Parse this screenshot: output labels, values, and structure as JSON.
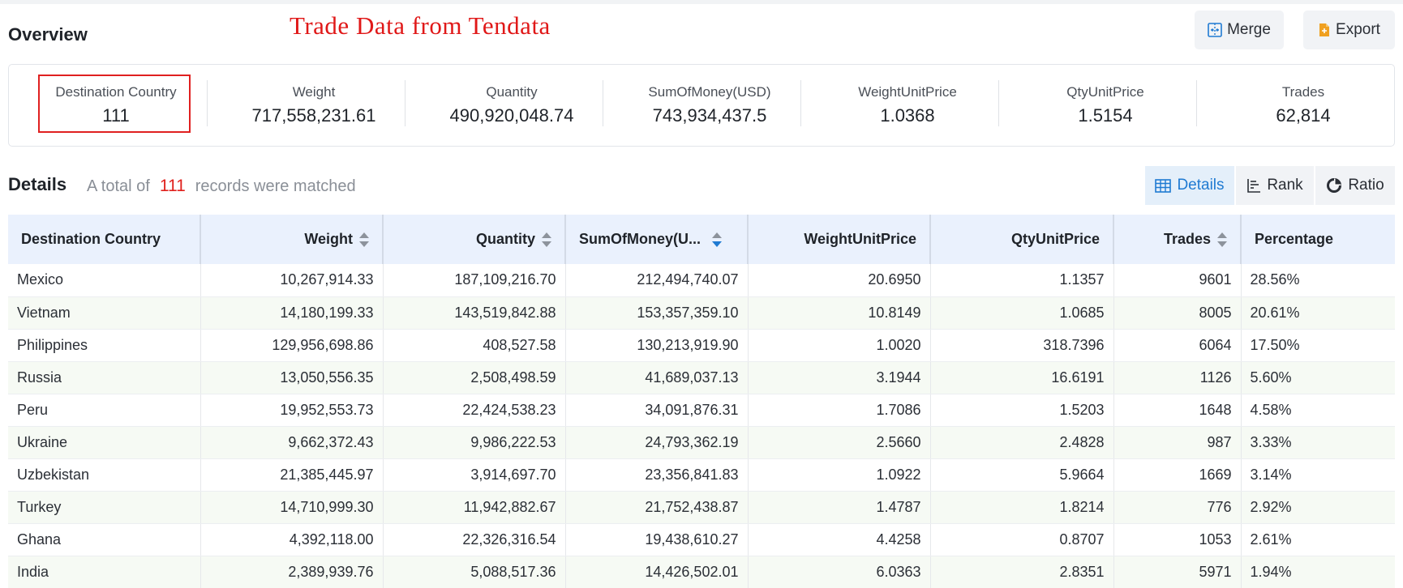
{
  "header": {
    "title": "Overview",
    "watermark": "Trade Data from Tendata",
    "merge_label": "Merge",
    "export_label": "Export"
  },
  "summary": [
    {
      "label": "Destination Country",
      "value": "111"
    },
    {
      "label": "Weight",
      "value": "717,558,231.61"
    },
    {
      "label": "Quantity",
      "value": "490,920,048.74"
    },
    {
      "label": "SumOfMoney(USD)",
      "value": "743,934,437.5"
    },
    {
      "label": "WeightUnitPrice",
      "value": "1.0368"
    },
    {
      "label": "QtyUnitPrice",
      "value": "1.5154"
    },
    {
      "label": "Trades",
      "value": "62,814"
    }
  ],
  "details": {
    "title": "Details",
    "prefix": "A total of",
    "count": "111",
    "suffix": "records were matched",
    "tabs": [
      {
        "label": "Details",
        "icon": "table-icon",
        "active": true
      },
      {
        "label": "Rank",
        "icon": "rank-icon",
        "active": false
      },
      {
        "label": "Ratio",
        "icon": "pie-icon",
        "active": false
      }
    ]
  },
  "table": {
    "columns": [
      "Destination Country",
      "Weight",
      "Quantity",
      "SumOfMoney(U...",
      "WeightUnitPrice",
      "QtyUnitPrice",
      "Trades",
      "Percentage"
    ],
    "rows": [
      [
        "Mexico",
        "10,267,914.33",
        "187,109,216.70",
        "212,494,740.07",
        "20.6950",
        "1.1357",
        "9601",
        "28.56%"
      ],
      [
        "Vietnam",
        "14,180,199.33",
        "143,519,842.88",
        "153,357,359.10",
        "10.8149",
        "1.0685",
        "8005",
        "20.61%"
      ],
      [
        "Philippines",
        "129,956,698.86",
        "408,527.58",
        "130,213,919.90",
        "1.0020",
        "318.7396",
        "6064",
        "17.50%"
      ],
      [
        "Russia",
        "13,050,556.35",
        "2,508,498.59",
        "41,689,037.13",
        "3.1944",
        "16.6191",
        "1126",
        "5.60%"
      ],
      [
        "Peru",
        "19,952,553.73",
        "22,424,538.23",
        "34,091,876.31",
        "1.7086",
        "1.5203",
        "1648",
        "4.58%"
      ],
      [
        "Ukraine",
        "9,662,372.43",
        "9,986,222.53",
        "24,793,362.19",
        "2.5660",
        "2.4828",
        "987",
        "3.33%"
      ],
      [
        "Uzbekistan",
        "21,385,445.97",
        "3,914,697.70",
        "23,356,841.83",
        "1.0922",
        "5.9664",
        "1669",
        "3.14%"
      ],
      [
        "Turkey",
        "14,710,999.30",
        "11,942,882.67",
        "21,752,438.87",
        "1.4787",
        "1.8214",
        "776",
        "2.92%"
      ],
      [
        "Ghana",
        "4,392,118.00",
        "22,326,316.54",
        "19,438,610.27",
        "4.4258",
        "0.8707",
        "1053",
        "2.61%"
      ],
      [
        "India",
        "2,389,939.76",
        "5,088,517.36",
        "14,426,502.01",
        "6.0363",
        "2.8351",
        "5971",
        "1.94%"
      ]
    ]
  },
  "colors": {
    "accent": "#1f7ad2",
    "highlight": "#e02020",
    "header_bg": "#eaf1fd",
    "alt_row": "#f6faf4"
  }
}
